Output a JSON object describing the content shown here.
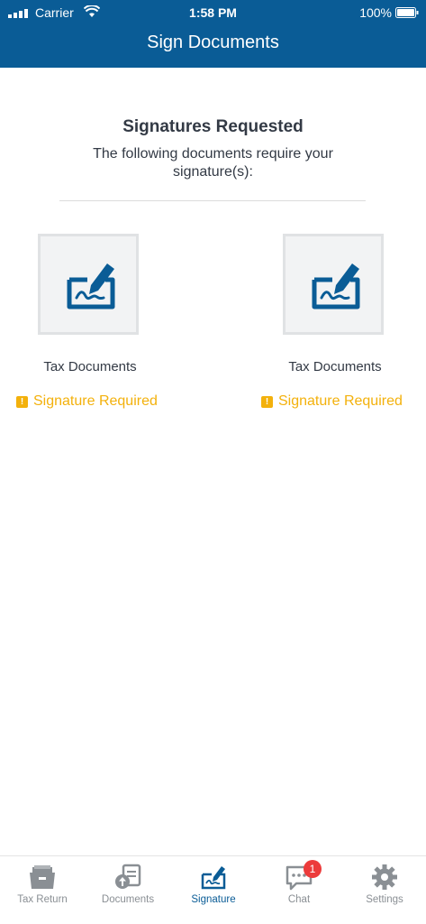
{
  "status_bar": {
    "carrier": "Carrier",
    "time": "1:58 PM",
    "battery": "100%"
  },
  "nav": {
    "title": "Sign Documents"
  },
  "content": {
    "title": "Signatures Requested",
    "subtitle": "The following documents require your signature(s):"
  },
  "documents": [
    {
      "name": "Tax Documents",
      "status": "Signature Required",
      "icon": "signature-icon"
    },
    {
      "name": "Tax Documents",
      "status": "Signature Required",
      "icon": "signature-icon"
    }
  ],
  "tabs": [
    {
      "label": "Tax Return",
      "icon": "folder-icon"
    },
    {
      "label": "Documents",
      "icon": "document-upload-icon"
    },
    {
      "label": "Signature",
      "icon": "signature-icon",
      "active": true
    },
    {
      "label": "Chat",
      "icon": "chat-icon",
      "badge": "1"
    },
    {
      "label": "Settings",
      "icon": "gear-icon"
    }
  ],
  "colors": {
    "brand": "#0a5c96",
    "warning": "#f3b10c",
    "badge": "#ec3b3b",
    "tab_inactive": "#8a8f94"
  }
}
